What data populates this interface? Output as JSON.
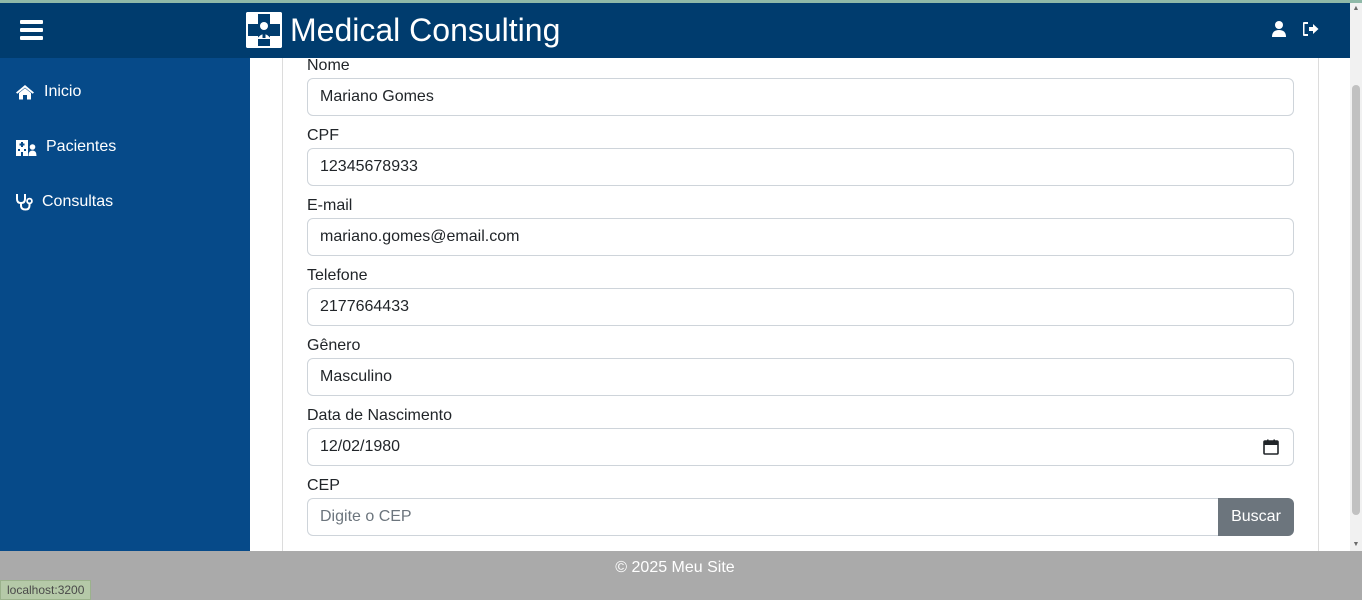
{
  "header": {
    "title": "Medical Consulting",
    "menu_icon": "hamburger-menu-icon",
    "logo_icon": "medical-logo-icon",
    "user_icon": "user-icon",
    "logout_icon": "sign-out-icon",
    "bg_color": "#003c6e"
  },
  "sidebar": {
    "bg_color": "#064a89",
    "items": [
      {
        "label": "Inicio",
        "icon": "home-icon"
      },
      {
        "label": "Pacientes",
        "icon": "hospital-user-icon"
      },
      {
        "label": "Consultas",
        "icon": "stethoscope-icon"
      }
    ]
  },
  "form": {
    "nome": {
      "label": "Nome",
      "value": "Mariano Gomes"
    },
    "cpf": {
      "label": "CPF",
      "value": "12345678933"
    },
    "email": {
      "label": "E-mail",
      "value": "mariano.gomes@email.com"
    },
    "telefone": {
      "label": "Telefone",
      "value": "2177664433"
    },
    "genero": {
      "label": "Gênero",
      "value": "Masculino"
    },
    "nascimento": {
      "label": "Data de Nascimento",
      "value": "12/02/1980",
      "icon": "calendar-icon"
    },
    "cep": {
      "label": "CEP",
      "value": "",
      "placeholder": "Digite o CEP",
      "button_label": "Buscar"
    }
  },
  "footer": {
    "text": "© 2025 Meu Site",
    "bg_color": "#aaaaaa"
  },
  "status_bar": {
    "url": "localhost:3200"
  }
}
